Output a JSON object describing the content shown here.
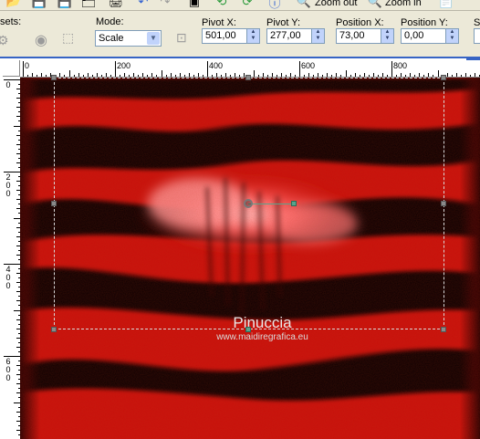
{
  "toolbar": {
    "zoom_out_label": "Zoom out",
    "zoom_in_label": "Zoom in"
  },
  "options": {
    "presets_label": "sets:",
    "mode_label": "Mode:",
    "mode_value": "Scale",
    "pivot_x_label": "Pivot X:",
    "pivot_x_value": "501,00",
    "pivot_y_label": "Pivot Y:",
    "pivot_y_value": "277,00",
    "position_x_label": "Position X:",
    "position_x_value": "73,00",
    "position_y_label": "Position Y:",
    "position_y_value": "0,00",
    "scale_label": "S"
  },
  "ruler": {
    "h_labels": [
      "0",
      "200",
      "400",
      "600",
      "800"
    ],
    "v_labels": [
      "0",
      "200",
      "400",
      "600"
    ]
  },
  "watermark": {
    "title": "Pinuccia",
    "url": "www.maidiregrafica.eu"
  },
  "colors": {
    "canvas_red": "#c81008",
    "handle_green": "#58a48c",
    "ruler_bg": "#ffffff",
    "window_border": "#3764c4"
  }
}
